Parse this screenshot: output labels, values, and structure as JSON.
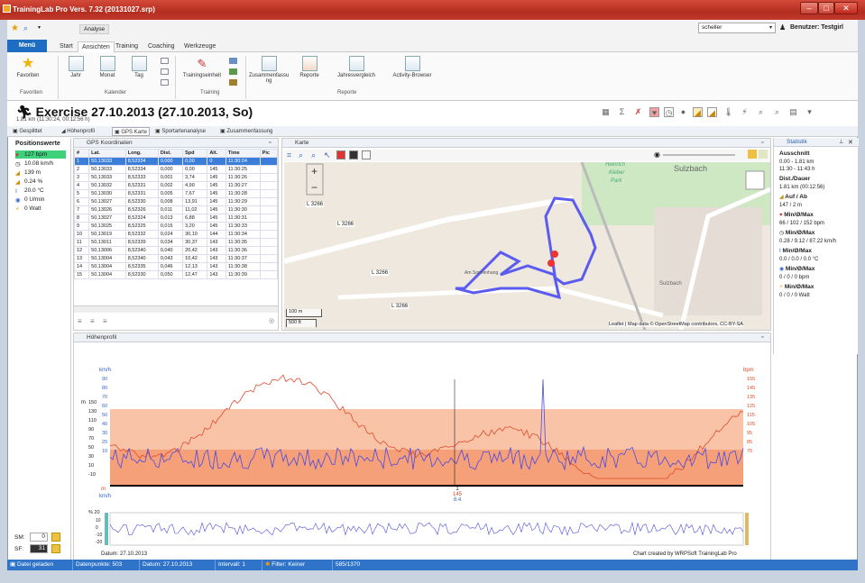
{
  "window": {
    "title": "TrainingLab Pro Vers. 7.32 (20131027.srp)"
  },
  "qat": {
    "context_tab": "Analyse",
    "user_select": "scheller",
    "user_label": "Benutzer: Testgirl"
  },
  "ribbon_tabs": [
    "Menü",
    "Start",
    "Ansichten",
    "Training",
    "Coaching",
    "Werkzeuge"
  ],
  "ribbon": {
    "favoriten": "Favoriten",
    "group_favoriten": "Favoriten",
    "jahr": "Jahr",
    "monat": "Monat",
    "tag": "Tag",
    "group_kalender": "Kalender",
    "trainingseinheit": "Trainingseinheit",
    "group_training": "Training",
    "zusammenfassung": "Zusammenfassu ng",
    "reporte": "Reporte",
    "jahresvergleich": "Jahresvergleich",
    "activity_browser": "Activity-Browser",
    "group_reporte": "Reporte"
  },
  "exercise": {
    "title": "Exercise 27.10.2013 (27.10.2013, So)",
    "subtitle": "1.81 km (11:30:24, 00:12:56 h)"
  },
  "view_tabs": [
    "Gesplittet",
    "Höhenprofil",
    "GPS Karte",
    "Sportartenanalyse",
    "Zusammenfassung"
  ],
  "positionswerte": {
    "title": "Positionswerte",
    "hr": "127 bpm",
    "speed": "10.08 km/h",
    "alt": "139 m",
    "grade": "0.24 %",
    "temp": "20.0 °C",
    "cad": "0 U/min",
    "power": "0 Watt",
    "sm_label": "SM:",
    "sm_val": "0",
    "sf_label": "SF:",
    "sf_val": "31"
  },
  "gps": {
    "title": "GPS Koordinaten",
    "columns": [
      "#",
      "Lat.",
      "Long.",
      "Dist.",
      "Spd",
      "Alt.",
      "Time",
      "Pic"
    ],
    "rows": [
      [
        "1",
        "50,13033",
        "8,52334",
        "0,000",
        "0,00",
        "0",
        "11:30:24",
        ""
      ],
      [
        "2",
        "50,13033",
        "8,52334",
        "0,000",
        "0,00",
        "145",
        "11:30:25",
        ""
      ],
      [
        "3",
        "50,13033",
        "8,52333",
        "0,001",
        "3,74",
        "145",
        "11:30:26",
        ""
      ],
      [
        "4",
        "50,13032",
        "8,52331",
        "0,002",
        "4,90",
        "145",
        "11:30:27",
        ""
      ],
      [
        "5",
        "50,13030",
        "8,52331",
        "0,005",
        "7,67",
        "145",
        "11:30:28",
        ""
      ],
      [
        "6",
        "50,13027",
        "8,52330",
        "0,008",
        "13,91",
        "145",
        "11:30:29",
        ""
      ],
      [
        "7",
        "50,13026",
        "8,52326",
        "0,011",
        "11,02",
        "145",
        "11:30:30",
        ""
      ],
      [
        "8",
        "50,13027",
        "8,52324",
        "0,013",
        "6,88",
        "145",
        "11:30:31",
        ""
      ],
      [
        "9",
        "50,13025",
        "8,52325",
        "0,015",
        "3,20",
        "145",
        "11:30:33",
        ""
      ],
      [
        "10",
        "50,13019",
        "8,52332",
        "0,024",
        "30,10",
        "144",
        "11:30:34",
        ""
      ],
      [
        "11",
        "50,13011",
        "8,52339",
        "0,034",
        "30,37",
        "143",
        "11:30:35",
        ""
      ],
      [
        "12",
        "50,13006",
        "8,52340",
        "0,040",
        "20,42",
        "143",
        "11:30:36",
        ""
      ],
      [
        "13",
        "50,13004",
        "8,52340",
        "0,043",
        "10,42",
        "143",
        "11:30:37",
        ""
      ],
      [
        "14",
        "50,13004",
        "8,52335",
        "0,046",
        "12,13",
        "143",
        "11:30:38",
        ""
      ],
      [
        "15",
        "50,13004",
        "8,52330",
        "0,050",
        "12,47",
        "143",
        "11:30:39",
        ""
      ]
    ]
  },
  "map": {
    "title": "Karte",
    "attribution": "Leaflet | Map data © OpenStreetMap contributors, CC-BY-SA",
    "scale_m": "100 m",
    "scale_ft": "500 ft",
    "place_heinrich": "Heinrich",
    "place_kleber": "Kleber",
    "place_park": "Park",
    "place_sulzbach": "Sulzbach",
    "road": "L 3266",
    "street1": "Am Sonnenhang"
  },
  "statistik": {
    "title": "Statistik",
    "ausschnitt": "Ausschnitt",
    "ausschnitt_v1": "0.00 - 1.81 km",
    "ausschnitt_v2": "11:30 - 11:43 h",
    "dist": "Dist./Dauer",
    "dist_v": "1.81 km (00:12:56)",
    "aufab": "Auf / Ab",
    "aufab_v": "147 / 2 m",
    "hr": "Min/Ø/Max",
    "hr_v": "66 / 102 / 152 bpm",
    "spd": "Min/Ø/Max",
    "spd_v": "0.28 / 9.12 / 87.22 km/h",
    "temp": "Min/Ø/Max",
    "temp_v": "0.0 / 0.0 / 0.0 °C",
    "cad": "Min/Ø/Max",
    "cad_v": "0 / 0 / 0 bpm",
    "pow": "Min/Ø/Max",
    "pow_v": "0 / 0 / 0 Watt"
  },
  "profile": {
    "title": "Höhenprofil",
    "unit_kmh": "km/h",
    "unit_m": "m",
    "unit_bpm": "bpm",
    "left_m": [
      "150",
      "130",
      "110",
      "90",
      "70",
      "50",
      "30",
      "10",
      "-10"
    ],
    "left_kmh": [
      "90",
      "80",
      "70",
      "60",
      "50",
      "40",
      "30",
      "20",
      "10"
    ],
    "right_bpm": [
      "155",
      "145",
      "135",
      "125",
      "115",
      "105",
      "95",
      "85",
      "75"
    ],
    "cursor_label1": "1",
    "cursor_label2": "145",
    "cursor_label3": "8.4",
    "bottom_unit_m": "m",
    "bottom_unit_kmh": "km/h",
    "grade_label": "% 20",
    "grade_ticks": [
      "10",
      "0",
      "-10",
      "-20"
    ],
    "date": "Datum: 27.10.2013",
    "credit": "Chart created by WRPSoft TrainingLab Pro"
  },
  "status": {
    "loaded": "Datei geladen",
    "points": "Datenpunkte: 503",
    "date": "Datum: 27.10.2013",
    "interval": "Intervall: 1",
    "filter": "Filter: Keiner",
    "pos": "585/1370"
  }
}
